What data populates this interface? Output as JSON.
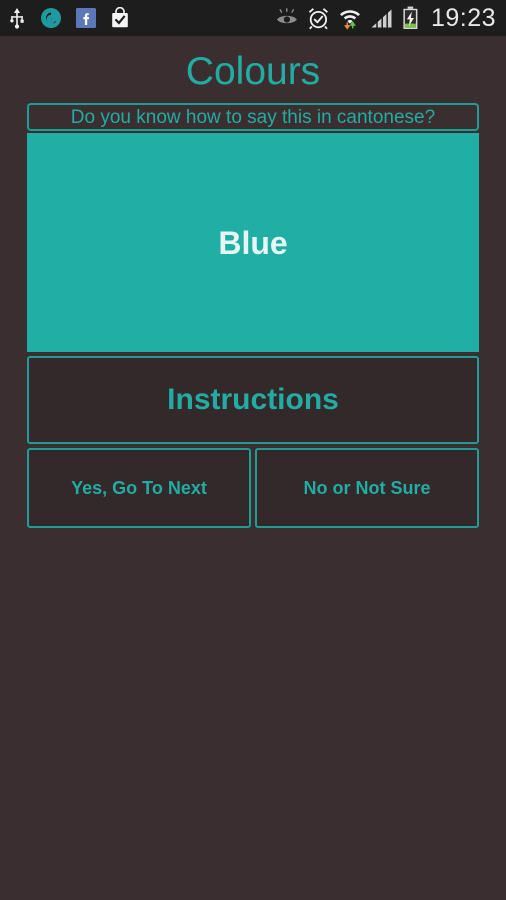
{
  "statusbar": {
    "time": "19:23",
    "left_icons": [
      {
        "name": "usb-icon",
        "label": "USB"
      },
      {
        "name": "google-icon",
        "label": "G"
      },
      {
        "name": "facebook-icon",
        "label": "f"
      },
      {
        "name": "shopping-bag-check-icon",
        "label": "Bag"
      }
    ],
    "right_icons": [
      {
        "name": "eye-icon",
        "label": "Smart stay"
      },
      {
        "name": "alarm-clock-icon",
        "label": "Alarm"
      },
      {
        "name": "wifi-transfer-icon",
        "label": "Wi-Fi"
      },
      {
        "name": "cellular-signal-icon",
        "label": "Signal"
      },
      {
        "name": "battery-charging-icon",
        "label": "Battery charging"
      }
    ]
  },
  "app": {
    "title": "Colours",
    "question": "Do you know how to say this in cantonese?",
    "word": "Blue",
    "instructions_label": "Instructions",
    "answers": [
      {
        "label": "Yes, Go To Next"
      },
      {
        "label": "No or Not Sure"
      }
    ]
  },
  "colors": {
    "accent_teal": "#21ada3",
    "panel_teal": "#21aea5",
    "background": "#3b2e30",
    "button_fill": "#33282a",
    "border_teal": "#1f9d94",
    "statusbar_bg": "#1d1d1d",
    "word_text": "#e6f6f5",
    "clock_text": "#e8e8e8"
  }
}
